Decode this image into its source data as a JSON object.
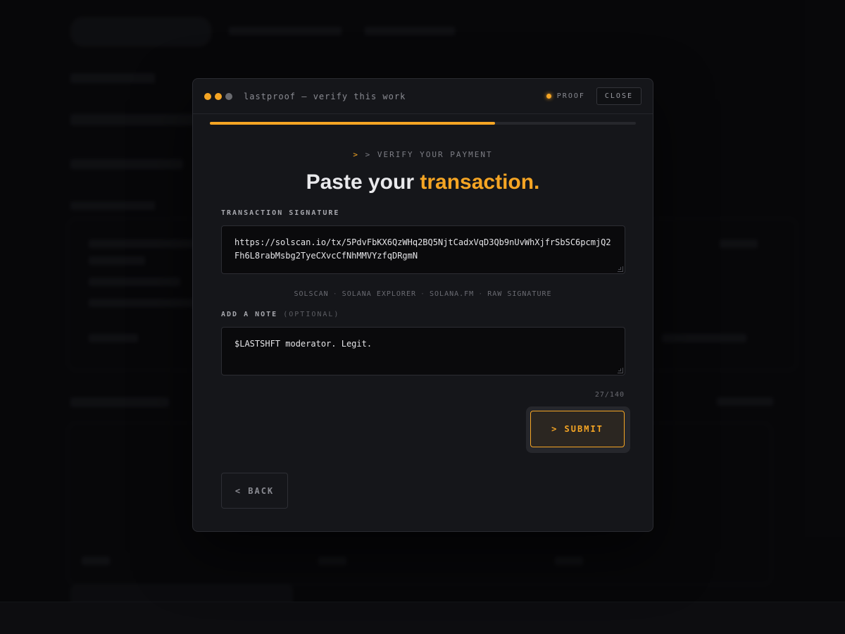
{
  "window": {
    "title": "lastproof — verify this work",
    "proof_label": "PROOF",
    "close_label": "CLOSE"
  },
  "progress": {
    "fraction": 0.67
  },
  "step": {
    "chevron": ">",
    "eyebrow": "> VERIFY YOUR PAYMENT",
    "headline_plain": "Paste your ",
    "headline_accent": "transaction."
  },
  "signature": {
    "label": "TRANSACTION SIGNATURE",
    "value": "https://solscan.io/tx/5PdvFbKX6QzWHq2BQ5NjtCadxVqD3Qb9nUvWhXjfrSbSC6pcmjQ2Fh6L8rabMsbg2TyeCXvcCfNhMMVYzfqDRgmN",
    "sources": [
      "SOLSCAN",
      "SOLANA EXPLORER",
      "SOLANA.FM",
      "RAW SIGNATURE"
    ],
    "separator": "·"
  },
  "note": {
    "label": "ADD A NOTE",
    "optional": "(OPTIONAL)",
    "value": "$LASTSHFT moderator. Legit.",
    "counter": "27/140"
  },
  "actions": {
    "submit": "> SUBMIT",
    "back": "< BACK"
  },
  "colors": {
    "accent": "#f5a524",
    "background": "#15161a",
    "field": "#0a0a0c"
  }
}
